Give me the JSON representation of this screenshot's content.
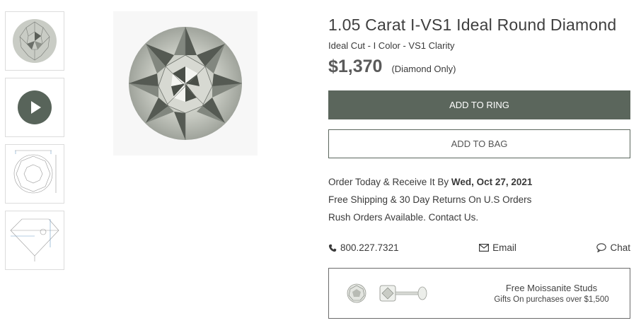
{
  "product": {
    "title": "1.05 Carat I-VS1 Ideal Round Diamond",
    "subtitle": "Ideal Cut - I Color - VS1 Clarity",
    "price": "$1,370",
    "price_note": "(Diamond Only)"
  },
  "actions": {
    "add_to_ring": "ADD TO RING",
    "add_to_bag": "ADD TO BAG"
  },
  "delivery": {
    "order_prefix": "Order Today & Receive It By ",
    "order_date": "Wed, Oct 27, 2021",
    "shipping": "Free Shipping & 30 Day Returns On U.S Orders",
    "rush": "Rush Orders Available. Contact Us."
  },
  "contact": {
    "phone": "800.227.7321",
    "email": "Email",
    "chat": "Chat"
  },
  "promo": {
    "title": "Free Moissanite Studs",
    "subtitle": "Gifts On purchases over $1,500"
  },
  "colors": {
    "accent": "#5b665c",
    "border": "#dcdcdc"
  }
}
